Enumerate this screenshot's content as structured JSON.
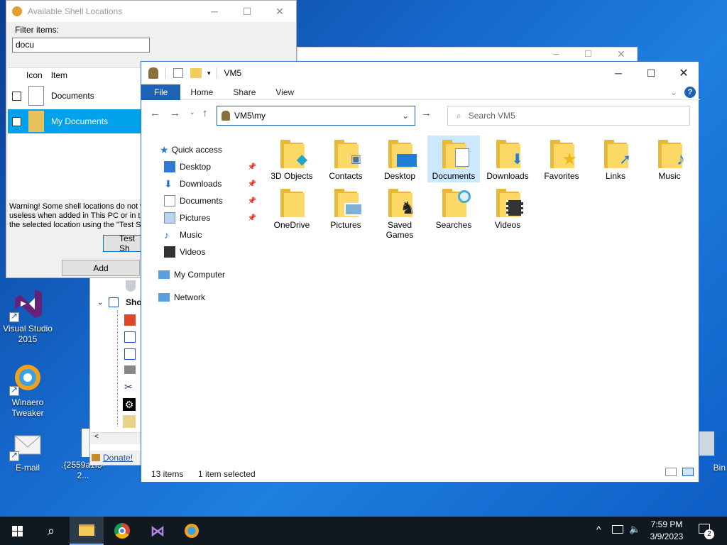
{
  "desktop": {
    "icons": [
      {
        "label": "Visual Studio 2015"
      },
      {
        "label": "Winaero Tweaker"
      },
      {
        "label": "E-mail"
      },
      {
        "label": ".{2559a1f5-2..."
      },
      {
        "label": "Bin"
      }
    ]
  },
  "bg_tweaker": {
    "tree_label": "Sho",
    "donate": "Donate!"
  },
  "shell_window": {
    "title": "Available Shell Locations",
    "filter_label": "Filter items:",
    "filter_value": "docu",
    "columns": [
      "Icon",
      "Item"
    ],
    "rows": [
      {
        "label": "Documents",
        "selected": false
      },
      {
        "label": "My Documents",
        "selected": true
      }
    ],
    "warning": "Warning! Some shell locations do not w\nuseless when added in This PC or in the\nthe selected location using the \"Test Sh",
    "test_button": "Test Sh",
    "add_button": "Add"
  },
  "explorer": {
    "title": "VM5",
    "tabs": [
      "File",
      "Home",
      "Share",
      "View"
    ],
    "address": "VM5\\my",
    "search_placeholder": "Search VM5",
    "nav": {
      "quick_access": "Quick access",
      "pinned": [
        "Desktop",
        "Downloads",
        "Documents",
        "Pictures"
      ],
      "others": [
        "Music",
        "Videos"
      ],
      "my_computer": "My Computer",
      "network": "Network"
    },
    "items": [
      {
        "label": "3D Objects",
        "overlay": "cube"
      },
      {
        "label": "Contacts",
        "overlay": "contact-card"
      },
      {
        "label": "Desktop",
        "overlay": "monitor"
      },
      {
        "label": "Documents",
        "overlay": "document",
        "selected": true
      },
      {
        "label": "Downloads",
        "overlay": "down-arrow"
      },
      {
        "label": "Favorites",
        "overlay": "star"
      },
      {
        "label": "Links",
        "overlay": "link-arrow"
      },
      {
        "label": "Music",
        "overlay": "note"
      },
      {
        "label": "OneDrive",
        "overlay": "none"
      },
      {
        "label": "Pictures",
        "overlay": "landscape"
      },
      {
        "label": "Saved Games",
        "overlay": "chess-piece"
      },
      {
        "label": "Searches",
        "overlay": "magnifier"
      },
      {
        "label": "Videos",
        "overlay": "film"
      }
    ],
    "status_count": "13 items",
    "status_selected": "1 item selected"
  },
  "taskbar": {
    "time": "7:59 PM",
    "date": "3/9/2023",
    "notifications": "2"
  },
  "colors": {
    "accent": "#1e62b6",
    "selection": "#cce8ff",
    "list_selection": "#00a2ed",
    "folder": "#fcd967"
  }
}
